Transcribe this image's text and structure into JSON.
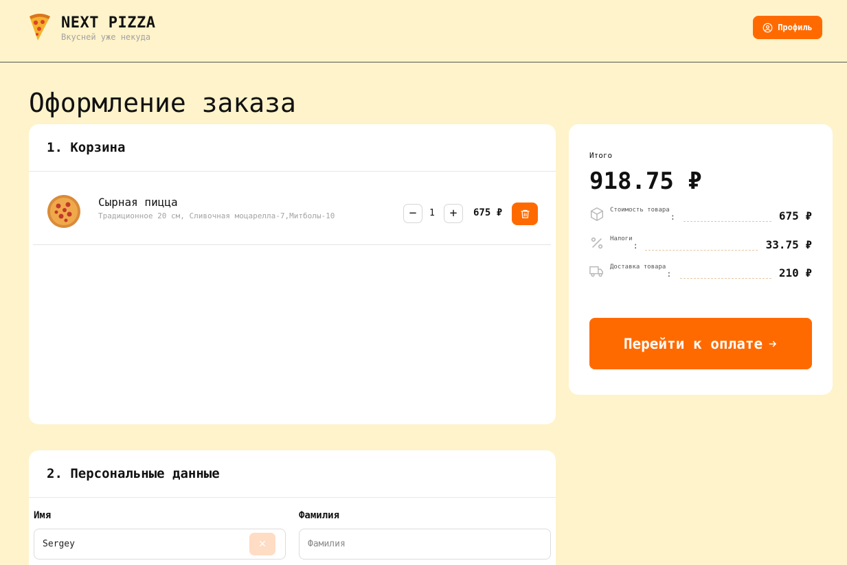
{
  "header": {
    "brand_title": "NEXT PIZZA",
    "brand_subtitle": "Вкусней уже некуда",
    "profile_label": "Профиль"
  },
  "page_title": "Оформление заказа",
  "cart": {
    "heading": "1. Корзина",
    "items": [
      {
        "name": "Сырная пицца",
        "description": "Традиционное 20 см, Сливочная моцарелла-7,Митболы-10",
        "quantity": "1",
        "price": "675 ₽"
      }
    ]
  },
  "personal": {
    "heading": "2. Персональные данные",
    "first_name_label": "Имя",
    "first_name_value": "Sergey",
    "last_name_label": "Фамилия",
    "last_name_placeholder": "Фамилия"
  },
  "summary": {
    "total_label": "Итого",
    "total_value": "918.75 ₽",
    "rows": [
      {
        "label": "Стоимость товара",
        "value": "675 ₽",
        "icon": "package-icon"
      },
      {
        "label": "Налоги",
        "value": "33.75 ₽",
        "icon": "percent-icon"
      },
      {
        "label": "Доставка товара",
        "value": "210 ₽",
        "icon": "truck-icon"
      }
    ],
    "pay_label": "Перейти к оплате"
  },
  "colors": {
    "accent": "#ff6a00",
    "background": "#fef3ca"
  }
}
